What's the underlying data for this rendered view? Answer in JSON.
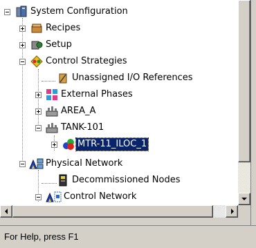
{
  "tree": {
    "items": [
      {
        "label": "System Configuration",
        "icon": "system-configuration-icon",
        "expander": "minus"
      },
      {
        "label": "Recipes",
        "icon": "recipes-icon",
        "expander": "plus"
      },
      {
        "label": "Setup",
        "icon": "setup-icon",
        "expander": "plus"
      },
      {
        "label": "Control Strategies",
        "icon": "control-strategies-icon",
        "expander": "minus"
      },
      {
        "label": "Unassigned I/O References",
        "icon": "io-reference-icon",
        "expander": "none"
      },
      {
        "label": "External Phases",
        "icon": "external-phases-icon",
        "expander": "plus"
      },
      {
        "label": "AREA_A",
        "icon": "area-icon",
        "expander": "plus"
      },
      {
        "label": "TANK-101",
        "icon": "unit-icon",
        "expander": "minus"
      },
      {
        "label": "MTR-11_ILOC_1",
        "icon": "module-icon",
        "expander": "plus",
        "selected": true
      },
      {
        "label": "Physical Network",
        "icon": "physical-network-icon",
        "expander": "minus"
      },
      {
        "label": "Decommissioned Nodes",
        "icon": "decommissioned-nodes-icon",
        "expander": "none"
      },
      {
        "label": "Control Network",
        "icon": "control-network-icon",
        "expander": "minus"
      }
    ]
  },
  "status_bar": {
    "text": "For Help, press F1"
  },
  "colors": {
    "selection": "#0a246a",
    "chrome": "#d4d0c8"
  }
}
